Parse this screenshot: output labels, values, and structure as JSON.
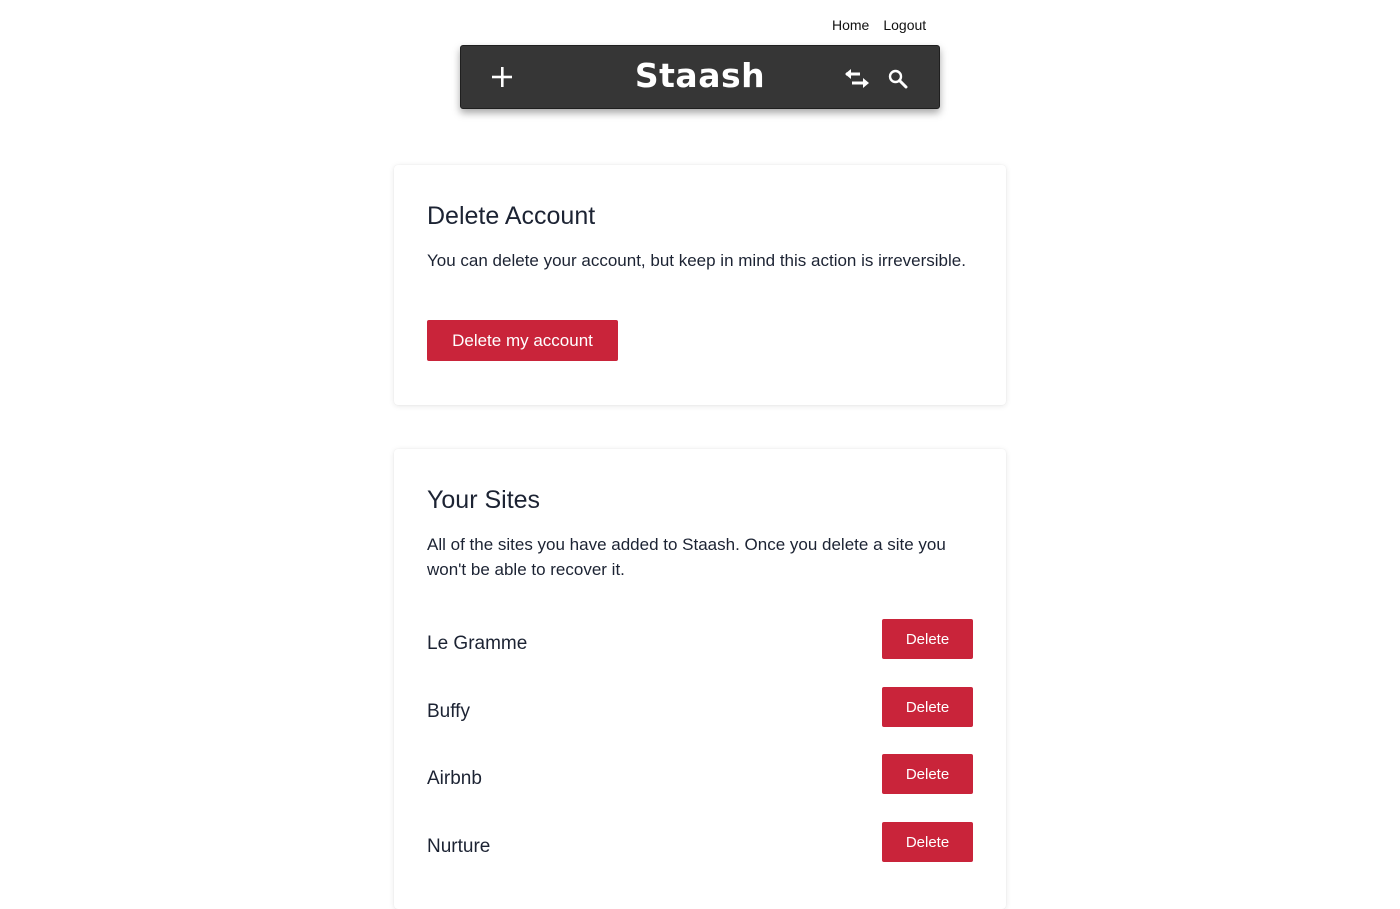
{
  "nav": {
    "home_label": "Home",
    "logout_label": "Logout"
  },
  "toolbar": {
    "title": "Staash",
    "add_icon": "plus-icon",
    "swap_icon": "swap-arrows-icon",
    "search_icon": "search-icon"
  },
  "delete_account": {
    "heading": "Delete Account",
    "description": "You can delete your account, but keep in mind this action is irreversible.",
    "button_label": "Delete my account"
  },
  "sites": {
    "heading": "Your Sites",
    "description": "All of the sites you have added to Staash. Once you delete a site you won't be able to recover it.",
    "items": [
      {
        "name": "Le Gramme",
        "delete_label": "Delete"
      },
      {
        "name": "Buffy",
        "delete_label": "Delete"
      },
      {
        "name": "Airbnb",
        "delete_label": "Delete"
      },
      {
        "name": "Nurture",
        "delete_label": "Delete"
      }
    ]
  },
  "colors": {
    "danger": "#c9243a",
    "toolbar_bg": "#363636",
    "text": "#1c2333"
  }
}
